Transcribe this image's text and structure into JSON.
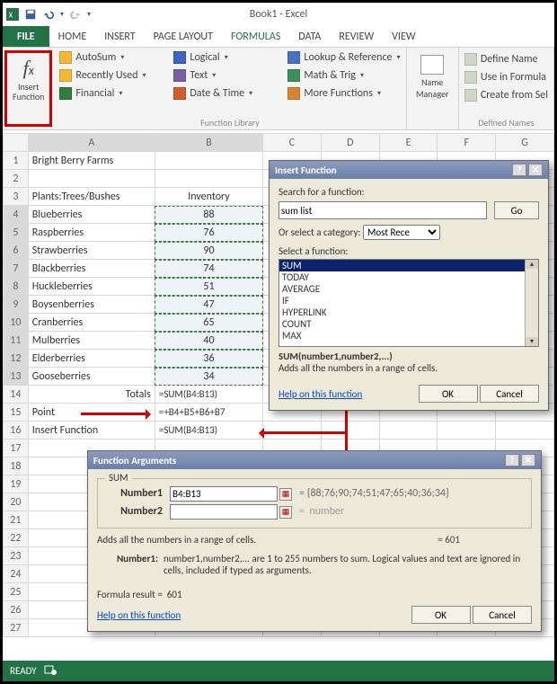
{
  "title": "Book1 - Excel",
  "tabs": [
    "FILE",
    "HOME",
    "INSERT",
    "PAGE LAYOUT",
    "FORMULAS",
    "DATA",
    "REVIEW",
    "VIEW"
  ],
  "active_tab": 4,
  "ribbon": {
    "insert_function_label": "Insert Function",
    "lib_group_label": "Function Library",
    "defn_group_label": "Defined Names",
    "name_manager": "Name Manager",
    "col1": [
      {
        "label": "AutoSum",
        "color": "#f5b733"
      },
      {
        "label": "Recently Used",
        "color": "#f5b733"
      },
      {
        "label": "Financial",
        "color": "#2d7f3a"
      }
    ],
    "col2": [
      {
        "label": "Logical",
        "color": "#3a63c9"
      },
      {
        "label": "Text",
        "color": "#7a5fa0"
      },
      {
        "label": "Date & Time",
        "color": "#cf5c2c"
      }
    ],
    "col3": [
      {
        "label": "Lookup & Reference",
        "color": "#4573c4"
      },
      {
        "label": "Math & Trig",
        "color": "#3b8f5c"
      },
      {
        "label": "More Functions",
        "color": "#d9842e"
      }
    ],
    "defn_items": [
      {
        "label": "Define Name"
      },
      {
        "label": "Use in Formula"
      },
      {
        "label": "Create from Sel"
      }
    ]
  },
  "columns": [
    "A",
    "B",
    "C",
    "D",
    "E",
    "F",
    "G"
  ],
  "rows": [
    {
      "n": 1,
      "a": "Bright Berry Farms",
      "b": ""
    },
    {
      "n": 2,
      "a": "",
      "b": ""
    },
    {
      "n": 3,
      "a": "Plants:Trees/Bushes",
      "b": "Inventory"
    },
    {
      "n": 4,
      "a": "Blueberries",
      "b": "88",
      "sel": true
    },
    {
      "n": 5,
      "a": "Raspberries",
      "b": "76",
      "sel": true
    },
    {
      "n": 6,
      "a": "Strawberries",
      "b": "90",
      "sel": true
    },
    {
      "n": 7,
      "a": "Blackberries",
      "b": "74",
      "sel": true
    },
    {
      "n": 8,
      "a": "Huckleberries",
      "b": "51",
      "sel": true
    },
    {
      "n": 9,
      "a": "Boysenberries",
      "b": "47",
      "sel": true
    },
    {
      "n": 10,
      "a": "Cranberries",
      "b": "65",
      "sel": true
    },
    {
      "n": 11,
      "a": "Mulberries",
      "b": "40",
      "sel": true
    },
    {
      "n": 12,
      "a": "Elderberries",
      "b": "36",
      "sel": true
    },
    {
      "n": 13,
      "a": "Gooseberries",
      "b": "34",
      "sel": true
    },
    {
      "n": 14,
      "a": "Totals",
      "b": "=SUM(B4:B13)",
      "a_r": true,
      "formula": true
    },
    {
      "n": 15,
      "a": "Point",
      "b": "=+B4+B5+B6+B7",
      "formula": true
    },
    {
      "n": 16,
      "a": "Insert Function",
      "b": "=SUM(B4:B13)",
      "formula": true
    },
    {
      "n": 17,
      "a": "",
      "b": ""
    },
    {
      "n": 18,
      "a": "",
      "b": ""
    },
    {
      "n": 19,
      "a": "",
      "b": ""
    },
    {
      "n": 20,
      "a": "",
      "b": ""
    },
    {
      "n": 21,
      "a": "",
      "b": ""
    },
    {
      "n": 22,
      "a": "",
      "b": ""
    },
    {
      "n": 23,
      "a": "",
      "b": ""
    },
    {
      "n": 24,
      "a": "",
      "b": ""
    },
    {
      "n": 25,
      "a": "",
      "b": ""
    },
    {
      "n": 26,
      "a": "",
      "b": ""
    },
    {
      "n": 27,
      "a": "",
      "b": ""
    }
  ],
  "status": "READY",
  "insert_dialog": {
    "title": "Insert Function",
    "search_label": "Search for a function:",
    "search_value": "sum list",
    "go": "Go",
    "category_label": "Or select a category:",
    "category_value": "Most Recently Used",
    "category_display": "Most Rece",
    "select_label": "Select a function:",
    "functions": [
      "SUM",
      "TODAY",
      "AVERAGE",
      "IF",
      "HYPERLINK",
      "COUNT",
      "MAX"
    ],
    "selected_index": 0,
    "signature": "SUM(number1,number2,...)",
    "desc": "Adds all the numbers in a range of cells.",
    "help": "Help on this function",
    "ok": "OK",
    "cancel": "Cancel"
  },
  "args_dialog": {
    "title": "Function Arguments",
    "fn_name": "SUM",
    "n1_label": "Number1",
    "n1_value": "B4:B13",
    "n1_preview": "{88;76;90;74;51;47;65;40;36;34}",
    "n2_label": "Number2",
    "n2_value": "",
    "n2_preview": "number",
    "eq": "=",
    "result_inline": "601",
    "desc": "Adds all the numbers in a range of cells.",
    "arg_name": "Number1:",
    "arg_desc": "number1,number2,... are 1 to 255 numbers to sum. Logical values and text are ignored in cells, included if typed as arguments.",
    "formula_result_label": "Formula result  =",
    "formula_result": "601",
    "help": "Help on this function",
    "ok": "OK",
    "cancel": "Cancel"
  },
  "chart_data": {
    "type": "table",
    "title": "Bright Berry Farms — Inventory",
    "categories": [
      "Blueberries",
      "Raspberries",
      "Strawberries",
      "Blackberries",
      "Huckleberries",
      "Boysenberries",
      "Cranberries",
      "Mulberries",
      "Elderberries",
      "Gooseberries"
    ],
    "values": [
      88,
      76,
      90,
      74,
      51,
      47,
      65,
      40,
      36,
      34
    ],
    "sum": 601
  }
}
